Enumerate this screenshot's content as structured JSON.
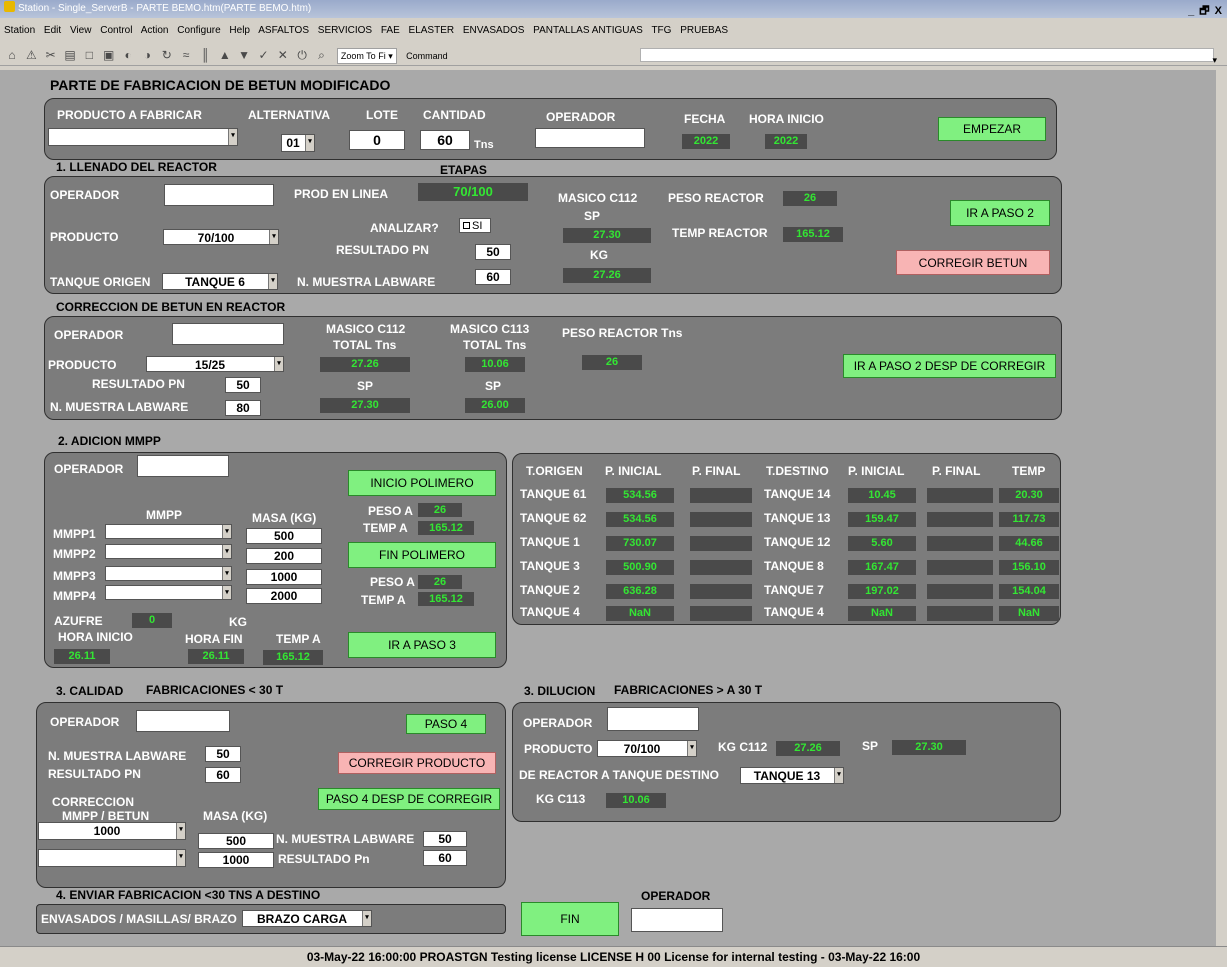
{
  "window": {
    "title": "Station - Single_ServerB - PARTE BEMO.htm(PARTE BEMO.htm)",
    "controls": "_ 🗗 X"
  },
  "menu": [
    "Station",
    "Edit",
    "View",
    "Control",
    "Action",
    "Configure",
    "Help",
    "ASFALTOS",
    "SERVICIOS",
    "FAE",
    "ELASTER",
    "ENVASADOS",
    "PANTALLAS ANTIGUAS",
    "TFG",
    "PRUEBAS"
  ],
  "toolbar": {
    "zoom": "Zoom To Fi",
    "command": "Command"
  },
  "form": {
    "title": "PARTE DE FABRICACION DE BETUN MODIFICADO"
  },
  "header": {
    "producto_label": "PRODUCTO A FABRICAR",
    "producto_value": "",
    "alternativa_label": "ALTERNATIVA",
    "alternativa_value": "01",
    "lote_label": "LOTE",
    "lote_value": "0",
    "cantidad_label": "CANTIDAD",
    "cantidad_value": "60",
    "cantidad_unit": "Tns",
    "operador_label": "OPERADOR",
    "operador_value": "",
    "fecha_label": "FECHA",
    "fecha_value": "2022",
    "hora_label": "HORA INICIO",
    "hora_value": "2022",
    "empezar_label": "EMPEZAR"
  },
  "paso1": {
    "section_label": "1. LLENADO DEL REACTOR",
    "etapas_label": "ETAPAS",
    "operador_label": "OPERADOR",
    "operador_value": "",
    "prod_linea_label": "PROD EN LINEA",
    "prod_linea_value": "70/100",
    "analizar_label": "ANALIZAR?",
    "analizar_check": "SI",
    "producto_label": "PRODUCTO",
    "producto_value": "70/100",
    "resultado_label": "RESULTADO PN",
    "resultado_value": "50",
    "tanque_label": "TANQUE ORIGEN",
    "tanque_value": "TANQUE 6",
    "muestra_label": "N. MUESTRA LABWARE",
    "muestra_value": "60",
    "masico_label": "MASICO C112",
    "sp_label": "SP",
    "sp_value": "27.30",
    "kg_label": "KG",
    "kg_value": "27.26",
    "peso_label": "PESO REACTOR",
    "peso_value": "26",
    "temp_label": "TEMP REACTOR",
    "temp_value": "165.12",
    "paso2_label": "IR A PASO 2",
    "corregir_label": "CORREGIR BETUN"
  },
  "correccion": {
    "section_label": "CORRECCION DE BETUN EN REACTOR",
    "operador_label": "OPERADOR",
    "operador_value": "",
    "producto_label": "PRODUCTO",
    "producto_value": "15/25",
    "resultado_label": "RESULTADO PN",
    "resultado_value": "50",
    "muestra_label": "N. MUESTRA LABWARE",
    "muestra_value": "80",
    "c112_label": "MASICO C112",
    "c112_total_label": "TOTAL Tns",
    "c112_total": "27.26",
    "c112_sp_label": "SP",
    "c112_sp": "27.30",
    "c113_label": "MASICO C113",
    "c113_total_label": "TOTAL Tns",
    "c113_total": "10.06",
    "c113_sp_label": "SP",
    "c113_sp": "26.00",
    "peso_label": "PESO REACTOR Tns",
    "peso_value": "26",
    "button_label": "IR A PASO 2 DESP DE CORREGIR"
  },
  "paso2": {
    "section_label": "2. ADICION MMPP",
    "operador_label": "OPERADOR",
    "operador_value": "",
    "mmpp_label": "MMPP",
    "masa_label": "MASA (KG)",
    "rows": [
      {
        "label": "MMPP1",
        "masa": "500"
      },
      {
        "label": "MMPP2",
        "masa": "200"
      },
      {
        "label": "MMPP3",
        "masa": "1000"
      },
      {
        "label": "MMPP4",
        "masa": "2000"
      }
    ],
    "azufre_label": "AZUFRE",
    "azufre_value": "0",
    "kg_label": "KG",
    "hora_inicio_label": "HORA INICIO",
    "hora_inicio_value": "26.11",
    "hora_fin_label": "HORA FIN",
    "hora_fin_value": "26.11",
    "temp_label": "TEMP A",
    "temp_value": "165.12",
    "inicio_polimero_label": "INICIO POLIMERO",
    "fin_polimero_label": "FIN POLIMERO",
    "peso1_label": "PESO A",
    "peso1_value": "26",
    "temp1_label": "TEMP A",
    "temp1_value": "165.12",
    "peso2_label": "PESO A",
    "peso2_value": "26",
    "temp2_label": "TEMP A",
    "temp2_value": "165.12",
    "paso3_label": "IR A PASO 3"
  },
  "tanks": {
    "headers": [
      "T.ORIGEN",
      "P. INICIAL",
      "P. FINAL",
      "T.DESTINO",
      "P. INICIAL",
      "P. FINAL",
      "TEMP"
    ],
    "rows": [
      {
        "origen": "TANQUE 61",
        "pi": "534.56",
        "pf": "",
        "destino": "TANQUE 14",
        "pi2": "10.45",
        "pf2": "",
        "temp": "20.30"
      },
      {
        "origen": "TANQUE 62",
        "pi": "534.56",
        "pf": "",
        "destino": "TANQUE 13",
        "pi2": "159.47",
        "pf2": "",
        "temp": "117.73"
      },
      {
        "origen": "TANQUE 1",
        "pi": "730.07",
        "pf": "",
        "destino": "TANQUE 12",
        "pi2": "5.60",
        "pf2": "",
        "temp": "44.66"
      },
      {
        "origen": "TANQUE 3",
        "pi": "500.90",
        "pf": "",
        "destino": "TANQUE 8",
        "pi2": "167.47",
        "pf2": "",
        "temp": "156.10"
      },
      {
        "origen": "TANQUE 2",
        "pi": "636.28",
        "pf": "",
        "destino": "TANQUE 7",
        "pi2": "197.02",
        "pf2": "",
        "temp": "154.04"
      },
      {
        "origen": "TANQUE 4",
        "pi": "NaN",
        "pf": "",
        "destino": "TANQUE 4",
        "pi2": "NaN",
        "pf2": "",
        "temp": "NaN"
      }
    ]
  },
  "paso3": {
    "section_label": "3. CALIDAD",
    "section_sub": "FABRICACIONES < 30 T",
    "operador_label": "OPERADOR",
    "operador_value": "",
    "muestra_label": "N. MUESTRA LABWARE",
    "muestra_value": "50",
    "resultado_label": "RESULTADO PN",
    "resultado_value": "60",
    "paso4_label": "PASO 4",
    "corregir_label": "CORREGIR PRODUCTO",
    "paso4_desp_label": "PASO 4 DESP DE CORREGIR",
    "correccion_label": "CORRECCION",
    "mmpp_betun_label": "MMPP / BETUN",
    "masa_label": "MASA (KG)",
    "corr1_select": "1000",
    "corr1_masa": "500",
    "corr2_select": "",
    "corr2_masa": "1000",
    "muestra2_label": "N. MUESTRA LABWARE",
    "muestra2_value": "50",
    "resultado2_label": "RESULTADO Pn",
    "resultado2_value": "60"
  },
  "dilucion": {
    "section_label": "3. DILUCION",
    "section_sub": "FABRICACIONES > A 30 T",
    "operador_label": "OPERADOR",
    "operador_value": "",
    "producto_label": "PRODUCTO",
    "producto_value": "70/100",
    "kg_c112_label": "KG C112",
    "kg_c112_value": "27.26",
    "sp_label": "SP",
    "sp_value": "27.30",
    "destino_label": "DE REACTOR A TANQUE DESTINO",
    "destino_value": "TANQUE 13",
    "kg_c113_label": "KG C113",
    "kg_c113_value": "10.06"
  },
  "paso4": {
    "section_label": "4. ENVIAR FABRICACION <30 TNS A DESTINO",
    "envasados_label": "ENVASADOS / MASILLAS/ BRAZO",
    "envasados_value": "BRAZO CARGA",
    "fin_label": "FIN",
    "operador_label": "OPERADOR",
    "operador_value": ""
  },
  "status": {
    "text": "03-May-22  16:00:00  PROASTGN   Testing license   LICENSE   H 00 License for internal testing - 03-May-22  16:00"
  }
}
